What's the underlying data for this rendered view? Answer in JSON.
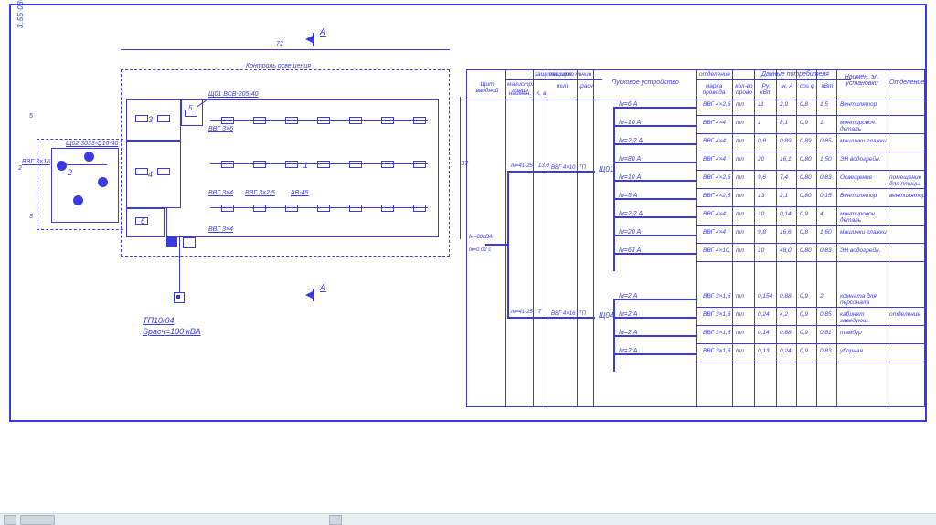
{
  "drawing_id": "3.55 030300",
  "section_mark": "A",
  "plan": {
    "caption_top": "Контроль освещения",
    "overall_width": "72",
    "overall_height": "37",
    "dim_left_upper": "5",
    "dim_left_mid": "2",
    "dim_left_lower": "3",
    "rooms": {
      "1": "1",
      "2": "2",
      "3": "3",
      "4": "4",
      "5": "5",
      "6": "6"
    },
    "callout_a": "Щ01    ВСВ-205-40",
    "callout_b": "Щ02    3033-Q10-40",
    "cable_a": "ВВГ 3×6",
    "cable_b": "ВВГ 3×4",
    "cable_c": "ВВГ 3×2,5",
    "cable_d": "АВ-45",
    "input_cable": "ВВГ 3×16",
    "tp_label_1": "ТП10/04",
    "tp_label_2": "Sрасч=100 кВА"
  },
  "schedule": {
    "headers": {
      "col_panel": "Щит вводной",
      "col_feeder": "магистр. линия",
      "col_prot_panel": "защитн. щит",
      "col_prot_line": "защитн. линии",
      "col_starter": "Пусковое устройство",
      "col_consumer": "Данные потребителя",
      "col_location": "Наимен. эл. установки",
      "col_room": "Отделение",
      "sub_name": "наимен.",
      "sub_k": "К, а",
      "sub_type": "тип",
      "sub_rated": "Iрасч",
      "sub_brand": "марка провода",
      "sub_qs": "кол-во прово",
      "sub_p": "Ру, кВт",
      "sub_i": "Iн, А",
      "sub_cos": "cos φ",
      "sub_kw": "кВт"
    },
    "trunk": {
      "panel_i": "Iн=80кВА",
      "panel_ik": "Iк=0,02 с",
      "feeder1": "Iн=41-25",
      "feeder1_len": "13,0",
      "feeder1_cable": "ВВГ 4×10",
      "feeder1_type": "ТП",
      "feeder1_target": "Щ01",
      "feeder2": "Iн=41-25",
      "feeder2_len": "7",
      "feeder2_cable": "ВВГ 4×16",
      "feeder2_type": "ТП",
      "feeder2_target": "Щ04"
    },
    "rows_g1": [
      {
        "i": "Iн=6 А",
        "cable": "ВВГ 4×2,5",
        "k": "тп",
        "n": "11",
        "p": "2,9",
        "cos": "0,8",
        "kw": "1,5",
        "loc": "Вентилятор",
        "room": ""
      },
      {
        "i": "Iн=10 А",
        "cable": "ВВГ 4×4",
        "k": "тп",
        "n": "1",
        "p": "8,1",
        "cos": "0,9",
        "kw": "1",
        "loc": "монтировоч. деталь",
        "room": ""
      },
      {
        "i": "Iн=2,2 А",
        "cable": "ВВГ 4×4",
        "k": "тп",
        "n": "0,8",
        "p": "0,89",
        "cos": "0,89",
        "kw": "0,85",
        "loc": "машинки глажки",
        "room": ""
      },
      {
        "i": "Iн=80 А",
        "cable": "ВВГ 4×4",
        "k": "тп",
        "n": "20",
        "p": "16,1",
        "cos": "0,80",
        "kw": "1,50",
        "loc": "ЭН водогрейн.",
        "room": ""
      },
      {
        "i": "Iн=10 А",
        "cable": "ВВГ 4×2,5",
        "k": "тп",
        "n": "9,6",
        "p": "7,4",
        "cos": "0,80",
        "kw": "0,83",
        "loc": "Освещение",
        "room": "помещение для птицы"
      },
      {
        "i": "Iн=5 А",
        "cable": "ВВГ 4×2,5",
        "k": "тп",
        "n": "13",
        "p": "2,1",
        "cos": "0,80",
        "kw": "0,15",
        "loc": "Вентилятор",
        "room": "вентилятор"
      },
      {
        "i": "Iн=2,2 А",
        "cable": "ВВГ 4×4",
        "k": "тп",
        "n": "10",
        "p": "0,14",
        "cos": "0,9",
        "kw": "4",
        "loc": "монтировоч. деталь",
        "room": ""
      },
      {
        "i": "Iн=20 А",
        "cable": "ВВГ 4×4",
        "k": "тп",
        "n": "9,8",
        "p": "16,6",
        "cos": "0,8",
        "kw": "1,60",
        "loc": "машинки глажки",
        "room": ""
      },
      {
        "i": "Iн=63 А",
        "cable": "ВВГ 4×10",
        "k": "тп",
        "n": "10",
        "p": "48,0",
        "cos": "0,80",
        "kw": "0,83",
        "loc": "ЭН водогрейн.",
        "room": ""
      }
    ],
    "rows_g2": [
      {
        "i": "Iн=2 А",
        "cable": "ВВГ 3×1,5",
        "k": "тп",
        "n": "0,154",
        "p": "0,88",
        "cos": "0,9",
        "kw": "2",
        "loc": "комната для персонала",
        "room": ""
      },
      {
        "i": "Iн=2 А",
        "cable": "ВВГ 3×1,5",
        "k": "тп",
        "n": "0,24",
        "p": "4,2",
        "cos": "0,9",
        "kw": "0,85",
        "loc": "кабинет заведующ.",
        "room": "отделение"
      },
      {
        "i": "Iн=2 А",
        "cable": "ВВГ 3×1,5",
        "k": "тп",
        "n": "0,14",
        "p": "0,88",
        "cos": "0,9",
        "kw": "0,81",
        "loc": "тамбур",
        "room": ""
      },
      {
        "i": "Iн=2 А",
        "cable": "ВВГ 3×1,5",
        "k": "тп",
        "n": "0,13",
        "p": "0,24",
        "cos": "0,9",
        "kw": "0,83",
        "loc": "уборная",
        "room": ""
      }
    ]
  }
}
